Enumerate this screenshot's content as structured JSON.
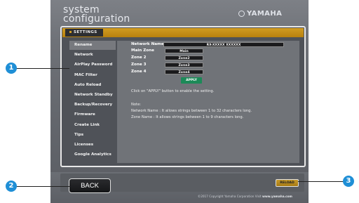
{
  "header": {
    "title_line1": "system",
    "title_line2": "configuration",
    "brand": "YAMAHA"
  },
  "tab": {
    "label": "SETTINGS"
  },
  "sidebar": {
    "items": [
      {
        "label": "Rename",
        "active": true
      },
      {
        "label": "Network"
      },
      {
        "label": "AirPlay Password"
      },
      {
        "label": "MAC Filter"
      },
      {
        "label": "Auto Reload"
      },
      {
        "label": "Network Standby"
      },
      {
        "label": "Backup/Recovery"
      },
      {
        "label": "Firmware"
      },
      {
        "label": "Create Link"
      },
      {
        "label": "Tips"
      },
      {
        "label": "Licenses"
      },
      {
        "label": "Google Analytics"
      }
    ]
  },
  "form": {
    "network_name": {
      "label": "Network Name",
      "value": "RX-XXXXX XXXXXX"
    },
    "main_zone": {
      "label": "Main Zone",
      "value": "Main"
    },
    "zone2": {
      "label": "Zone 2",
      "value": "Zone2"
    },
    "zone3": {
      "label": "Zone 3",
      "value": "Zone3"
    },
    "zone4": {
      "label": "Zone 4",
      "value": "Zone4"
    },
    "apply_label": "APPLY",
    "instruction": "Click on \"APPLY\" button to enable the setting.",
    "note_title": "Note:",
    "note_network": "Network Name : It allows strings between 1 to 32 characters long.",
    "note_zone": "Zone Name : It allows strings between 1 to 9 characters long."
  },
  "footer": {
    "back_label": "BACK",
    "reload_label": "RELOAD",
    "copyright": "©2017 Copyright Yamaha Corporation Visit",
    "site": "www.yamaha.com"
  },
  "callouts": {
    "one": "1",
    "two": "2",
    "three": "3"
  },
  "colors": {
    "accent_gold": "#c99420",
    "callout_blue": "#1f8fd6",
    "apply_green": "#1c8a58"
  }
}
